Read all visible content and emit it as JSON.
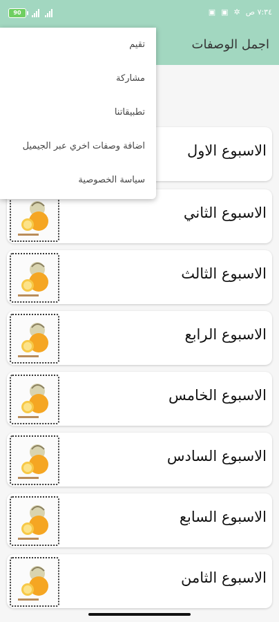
{
  "status_bar": {
    "battery": "90",
    "time": "٧:٣٤ ص",
    "icons": [
      "battery-icon",
      "signal-icon",
      "signal-icon",
      "wifi-icon",
      "sim-icon",
      "sim-icon",
      "gear-icon"
    ]
  },
  "app": {
    "title": "اجمل الوصفات",
    "accent_color": "#a2d7c0"
  },
  "menu": {
    "items": [
      {
        "label": "تقيم"
      },
      {
        "label": "مشاركة"
      },
      {
        "label": "تطبيقاتنا"
      },
      {
        "label": "اضافة وصفات اخري عبر الجيميل"
      },
      {
        "label": "سياسة الخصوصية"
      }
    ]
  },
  "weeks": [
    {
      "label": "الاسبوع الاول"
    },
    {
      "label": "الاسبوع الثاني"
    },
    {
      "label": "الاسبوع الثالث"
    },
    {
      "label": "الاسبوع الرابع"
    },
    {
      "label": "الاسبوع الخامس"
    },
    {
      "label": "الاسبوع السادس"
    },
    {
      "label": "الاسبوع السابع"
    },
    {
      "label": "الاسبوع الثامن"
    }
  ]
}
